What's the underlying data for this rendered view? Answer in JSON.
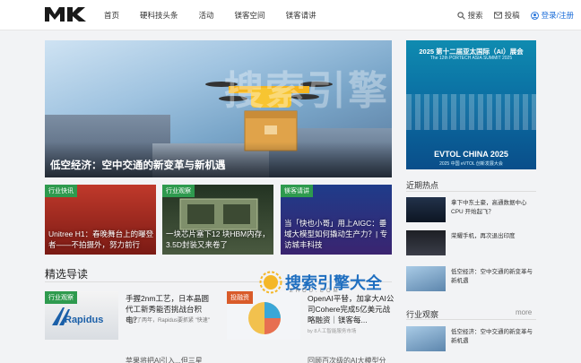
{
  "header": {
    "nav": [
      "首页",
      "硬科技头条",
      "活动",
      "镁客空间",
      "镁客请讲"
    ],
    "search_label": "搜索",
    "submit_label": "投稿",
    "login_label": "登录/注册"
  },
  "hero": {
    "title": "低空经济：空中交通的新变革与新机遇",
    "watermark": "搜索引擎"
  },
  "cards": [
    {
      "tag": "行业快讯",
      "caption": "Unitree H1：春晚舞台上的曝登者——不拍摄外，努力前行"
    },
    {
      "tag": "行业观察",
      "caption": "一块芯片塞下12 块HBM内存，3.5D封装又来卷了"
    },
    {
      "tag": "镁客请讲",
      "caption": "当「快也小哥」用上AIGC：垂域大模型如何撬动生产力？| 专访城丰科技"
    }
  ],
  "side_ad": {
    "line1": "2025 第十二届亚太国际（AI）展会",
    "line2": "The 12th PORTECH ASIA SUMMIT 2025",
    "line3": "EVTOL CHINA 2025",
    "line4": "2025 中国 eVTOL 创新发展大会"
  },
  "hot": {
    "title": "近期热点",
    "items": [
      {
        "text": "拿下中东土豪，高通数据中心CPU 开始起飞？"
      },
      {
        "text": "荣耀手机，再次退出印度"
      },
      {
        "text": "低空经济：空中交通的新变革与新机遇"
      }
    ]
  },
  "industry": {
    "title": "行业观察",
    "more": "more",
    "items": [
      {
        "text": "低空经济：空中交通的新变革与新机遇"
      }
    ]
  },
  "picks": {
    "title": "精选导读",
    "articles": [
      {
        "tag": "行业观察",
        "thumb_text": "Rapidus",
        "title": "手握2nm工艺，日本晶圆代工新秀能否挑战台积电？",
        "sub": "在近了两年，Rapidus要抓紧 \"快速\"",
        "meta": ""
      },
      {
        "tag": "投融资",
        "thumb_text": "",
        "title": "OpenAI平替，加拿大AI公司Cohere完成5亿美元战略融资｜镁客每...",
        "sub": "",
        "meta": "by 8人工智能服务市场"
      }
    ],
    "peek": [
      "苹果将把Al引入...但三星",
      "回顾百次级的AI大模型分"
    ]
  },
  "overlay": {
    "brand": "搜索引擎大全",
    "en": "ZHOU.COM"
  }
}
